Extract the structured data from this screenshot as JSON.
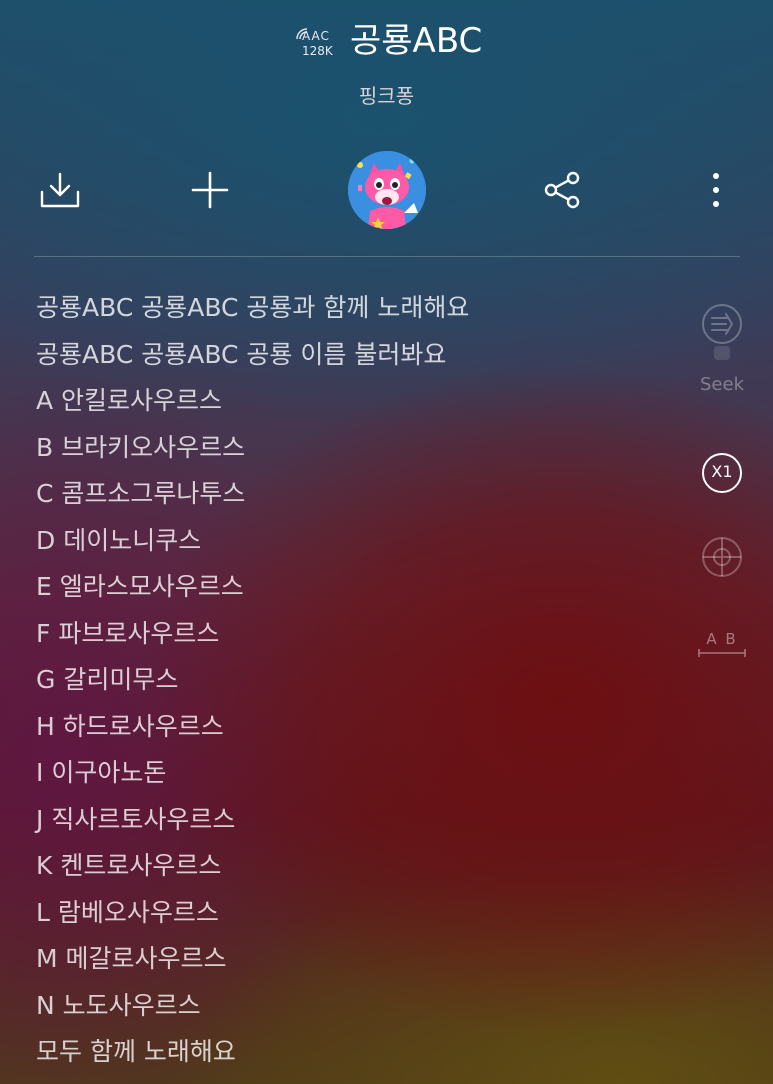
{
  "header": {
    "codec_format": "AAC",
    "codec_bitrate": "128K",
    "title": "공룡ABC",
    "artist": "핑크퐁"
  },
  "toolbar": {
    "icons": [
      "download-icon",
      "add-icon",
      "album-art",
      "share-icon",
      "more-icon"
    ]
  },
  "lyrics": [
    "공룡ABC 공룡ABC 공룡과 함께 노래해요",
    "공룡ABC 공룡ABC 공룡 이름 불러봐요",
    "A 안킬로사우르스",
    "B 브라키오사우르스",
    "C 콤프소그루나투스",
    "D 데이노니쿠스",
    "E 엘라스모사우르스",
    "F 파브로사우르스",
    "G 갈리미무스",
    "H 하드로사우르스",
    "I 이구아노돈",
    "J 직사르토사우르스",
    "K 켄트로사우르스",
    "L 람베오사우르스",
    "M 메갈로사우르스",
    "N 노도사우르스",
    "모두 함께 노래해요"
  ],
  "side_controls": {
    "seek_label": "Seek",
    "speed_label": "X1",
    "ab_label": "A B"
  },
  "colors": {
    "text_primary": "#ffffff",
    "text_lyric": "#e6e0e4",
    "dim_icon": "#8a8088"
  }
}
